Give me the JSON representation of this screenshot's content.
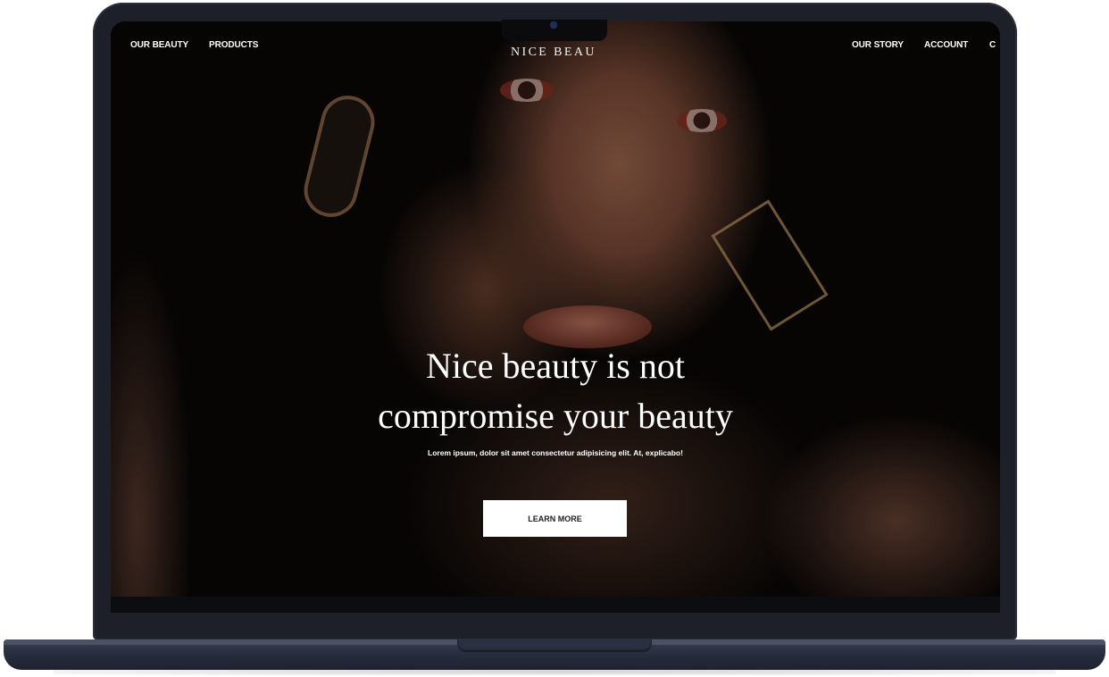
{
  "nav": {
    "left": [
      "OUR BEAUTY",
      "PRODUCTS"
    ],
    "logo": "NICE BEAU",
    "right": [
      "OUR STORY",
      "ACCOUNT",
      "C"
    ]
  },
  "hero": {
    "title_line1": "Nice beauty is not",
    "title_line2": "compromise your beauty",
    "subtitle": "Lorem ipsum, dolor sit amet consectetur adipisicing elit. At, explicabo!",
    "button_label": "LEARN MORE",
    "image_alt": "portrait-of-woman-with-red-eyeshadow"
  },
  "colors": {
    "laptop_body": "#1d2029",
    "laptop_base": "#2a3040",
    "button_bg": "#ffffff",
    "text": "#ffffff"
  }
}
